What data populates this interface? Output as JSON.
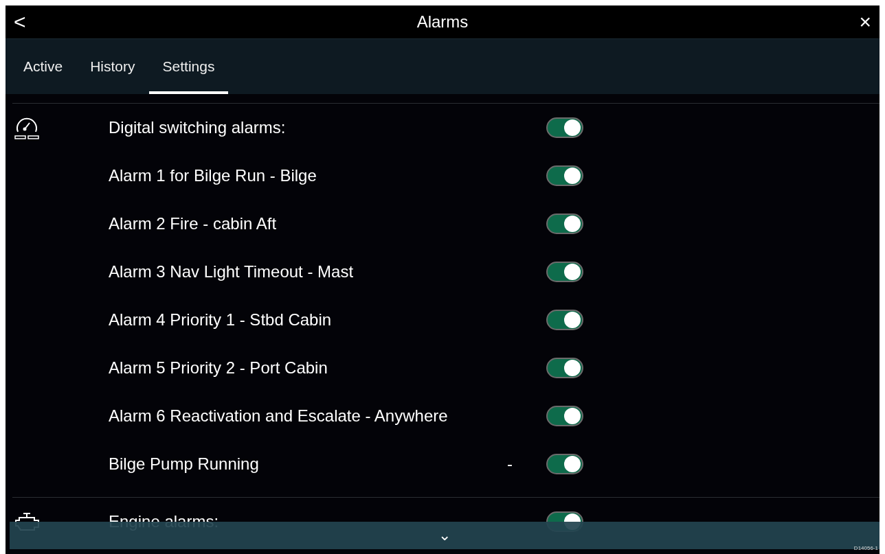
{
  "window": {
    "title": "Alarms",
    "back": "<",
    "close": "×"
  },
  "tabs": [
    {
      "label": "Active",
      "selected": false
    },
    {
      "label": "History",
      "selected": false
    },
    {
      "label": "Settings",
      "selected": true
    }
  ],
  "sections": [
    {
      "kind": "gauge",
      "header": {
        "label": "Digital switching alarms:",
        "on": true
      },
      "rows": [
        {
          "label": "Alarm 1 for Bilge Run - Bilge",
          "on": true
        },
        {
          "label": "Alarm 2 Fire - cabin Aft",
          "on": true
        },
        {
          "label": "Alarm 3  Nav Light Timeout - Mast",
          "on": true
        },
        {
          "label": "Alarm 4 Priority 1 - Stbd Cabin",
          "on": true
        },
        {
          "label": "Alarm 5 Priority 2 - Port Cabin",
          "on": true
        },
        {
          "label": "Alarm 6 Reactivation and Escalate - Anywhere",
          "on": true
        },
        {
          "label": "Bilge Pump Running",
          "value": "-",
          "on": true
        }
      ]
    },
    {
      "kind": "engine",
      "header": {
        "label": "Engine alarms:",
        "on": true
      }
    }
  ],
  "scroll_bar": {
    "arrow": "⌄"
  },
  "figure_code": "D14056-1"
}
